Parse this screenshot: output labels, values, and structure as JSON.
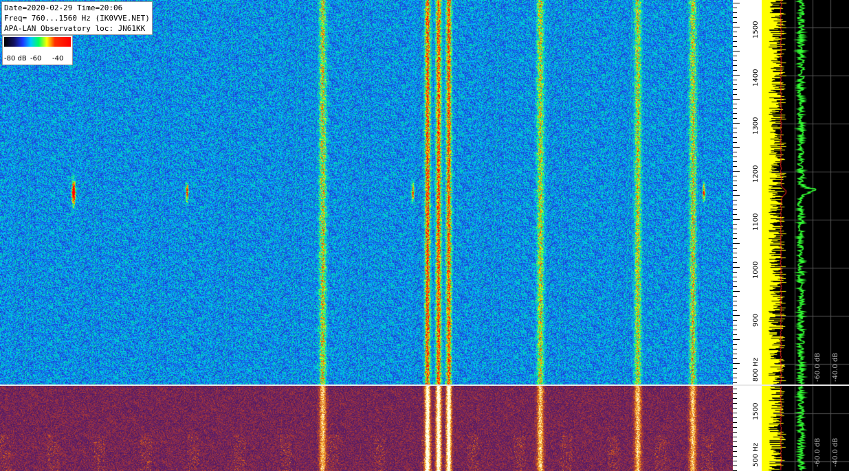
{
  "info": {
    "line1": "Date=2020-02-29 Time=20:06",
    "line2": "Freq= 760...1560 Hz (IK0VVE.NET)",
    "line3": "APA-LAN Observatory loc: JN61KK"
  },
  "colorbar": {
    "l1": "-80 dB",
    "l2": "-60",
    "l3": "-40"
  },
  "freq_axis": {
    "labels": [
      "1500",
      "1400",
      "1300",
      "1200",
      "1100",
      "1000",
      "900",
      "800 Hz"
    ],
    "bottom_labels": [
      "1500",
      "500 Hz"
    ]
  },
  "spectrum": {
    "db_labels": [
      "-60.0 dB",
      "-40.0 dB"
    ],
    "db_labels_bot": [
      "-60.0 dB",
      "-40.0 dB"
    ]
  },
  "signals": {
    "vertical_lines_x_fraction": [
      0.44,
      0.583,
      0.598,
      0.612,
      0.737,
      0.87,
      0.945
    ],
    "blips_x_fraction": [
      0.1,
      0.255,
      0.563,
      0.96
    ]
  }
}
